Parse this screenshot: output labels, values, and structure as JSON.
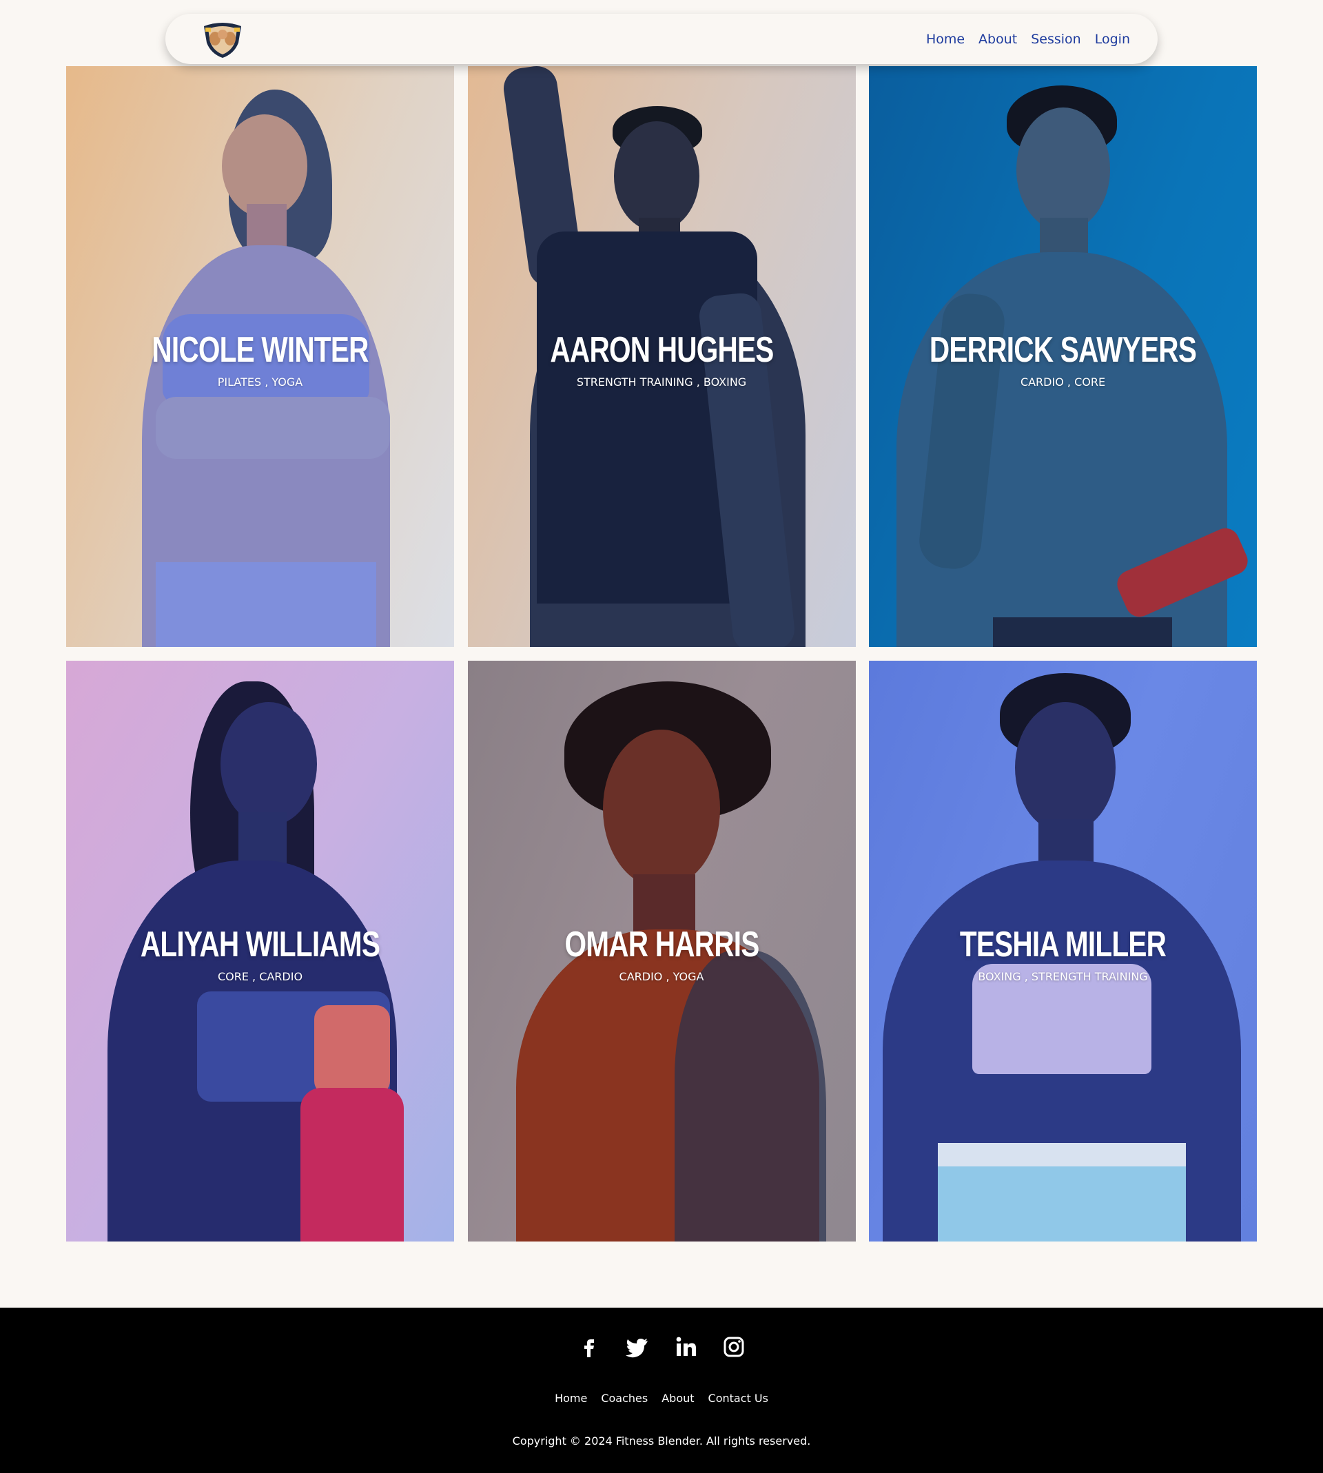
{
  "nav": {
    "logo_icon": "gym-shield-logo",
    "links": [
      "Home",
      "About",
      "Session",
      "Login"
    ]
  },
  "coaches": [
    {
      "name": "NICOLE WINTER",
      "specialties": "PILATES , YOGA"
    },
    {
      "name": "AARON HUGHES",
      "specialties": "STRENGTH TRAINING , BOXING"
    },
    {
      "name": "DERRICK SAWYERS",
      "specialties": "CARDIO , CORE"
    },
    {
      "name": "ALIYAH WILLIAMS",
      "specialties": "CORE , CARDIO"
    },
    {
      "name": "OMAR HARRIS",
      "specialties": "CARDIO , YOGA"
    },
    {
      "name": "TESHIA MILLER",
      "specialties": "BOXING , STRENGTH TRAINING"
    }
  ],
  "footer": {
    "social_icons": [
      "facebook-icon",
      "twitter-icon",
      "linkedin-icon",
      "instagram-icon"
    ],
    "links": [
      "Home",
      "Coaches",
      "About",
      "Contact Us"
    ],
    "copyright": "Copyright © 2024 Fitness Blender. All rights reserved."
  },
  "colors": {
    "page_bg": "#faf7f3",
    "nav_link": "#1f3c9e",
    "footer_bg": "#000000"
  }
}
